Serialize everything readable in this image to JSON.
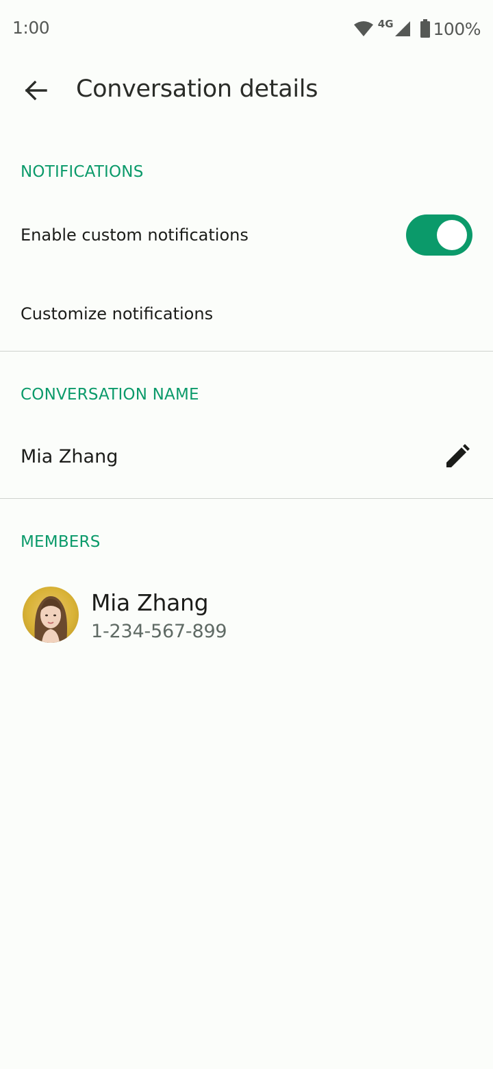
{
  "status_bar": {
    "time": "1:00",
    "network": "4G",
    "battery": "100%"
  },
  "app_bar": {
    "title": "Conversation details"
  },
  "notifications": {
    "header": "NOTIFICATIONS",
    "enable_label": "Enable custom notifications",
    "enabled": true,
    "customize_label": "Customize notifications"
  },
  "conversation_name": {
    "header": "CONVERSATION NAME",
    "value": "Mia Zhang"
  },
  "members": {
    "header": "MEMBERS",
    "items": [
      {
        "name": "Mia Zhang",
        "phone": "1-234-567-899"
      }
    ]
  },
  "colors": {
    "accent": "#0b9a6a",
    "background": "#fbfdfa"
  }
}
